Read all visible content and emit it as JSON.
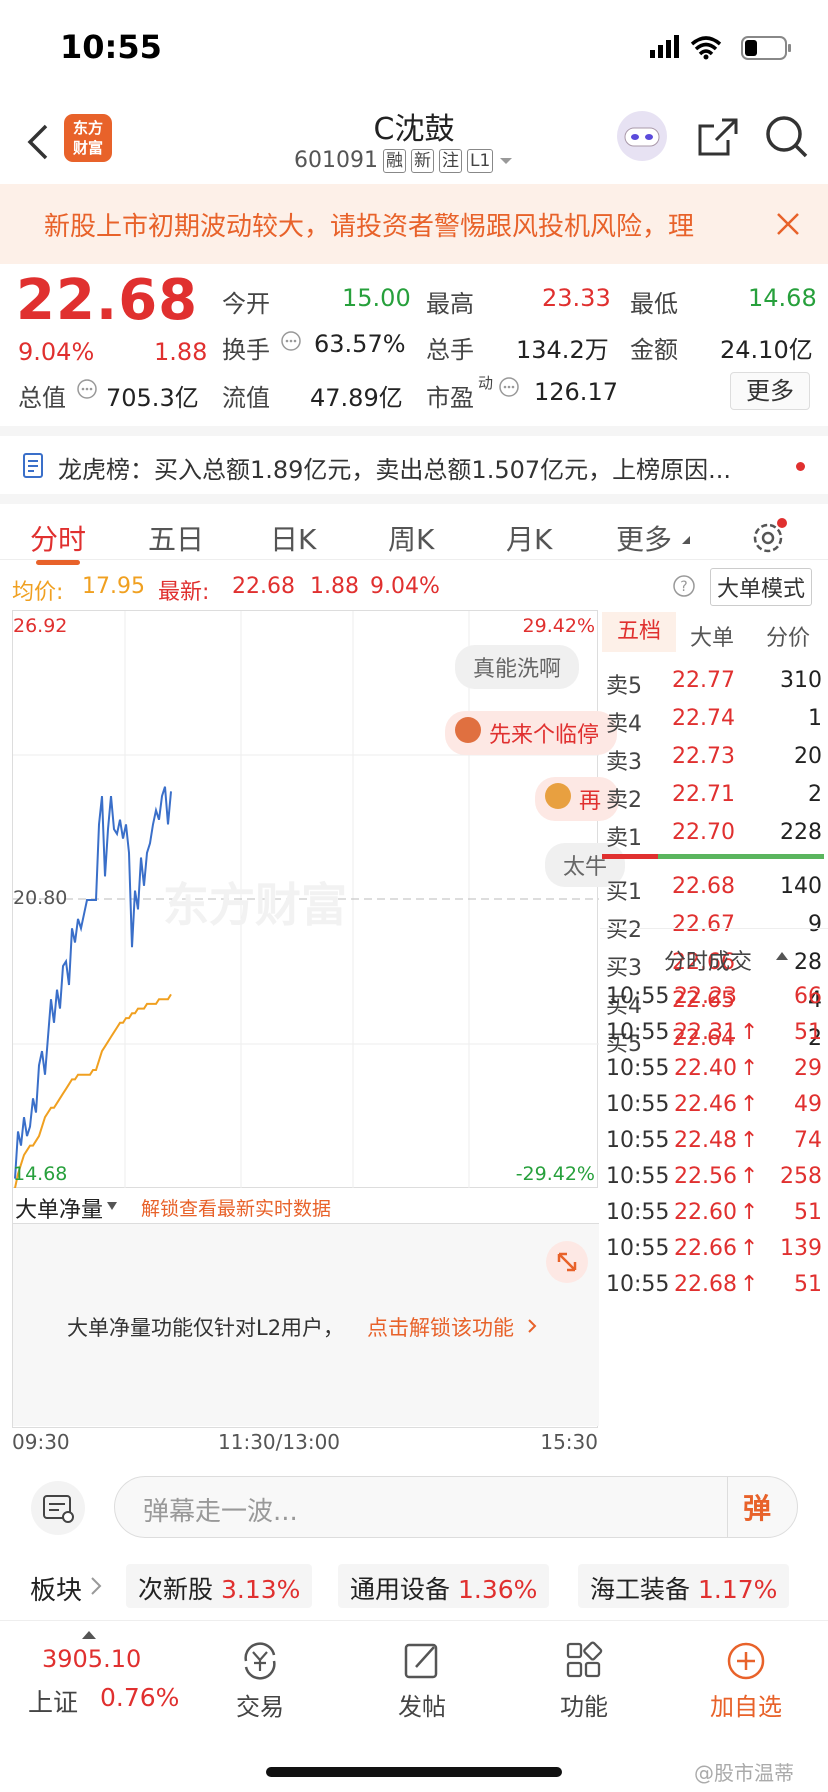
{
  "status_bar": {
    "time": "10:55"
  },
  "header": {
    "title": "C沈鼓",
    "code": "601091",
    "tags": [
      "融",
      "新",
      "注",
      "L1"
    ],
    "logo_text": "东方财富"
  },
  "warning": {
    "text": "新股上市初期波动较大，请投资者警惕跟风投机风险，理"
  },
  "quote": {
    "price": "22.68",
    "change_pct": "9.04%",
    "change": "1.88",
    "open_label": "今开",
    "open": "15.00",
    "high_label": "最高",
    "high": "23.33",
    "low_label": "最低",
    "low": "14.68",
    "turnover_label": "换手",
    "turnover": "63.57%",
    "volume_label": "总手",
    "volume": "134.2万",
    "amount_label": "金额",
    "amount": "24.10亿",
    "mktcap_label": "总值",
    "mktcap": "705.3亿",
    "float_label": "流值",
    "float": "47.89亿",
    "pe_label": "市盈",
    "pe_sup": "动",
    "pe": "126.17",
    "more": "更多"
  },
  "dragon_tiger": {
    "text": "龙虎榜：买入总额1.89亿元，卖出总额1.507亿元，上榜原因..."
  },
  "tabs": [
    "分时",
    "五日",
    "日K",
    "周K",
    "月K",
    "更多"
  ],
  "info_bar": {
    "avg_label": "均价:",
    "avg": "17.95",
    "latest_label": "最新:",
    "latest": "22.68",
    "chg": "1.88",
    "pct": "9.04%",
    "mode": "大单模式"
  },
  "chart_labels": {
    "y_max": "26.92",
    "y_mid": "20.80",
    "y_min": "14.68",
    "pct_max": "29.42%",
    "pct_min": "-29.42%",
    "watermark": "东方财富"
  },
  "danmaku": [
    "真能洗啊",
    "先来个临停",
    "再",
    "太牛"
  ],
  "chart_data": {
    "type": "line",
    "ylim": [
      14.68,
      26.92
    ],
    "series": [
      {
        "values": [
          14.9,
          15.9,
          15.6,
          16.2,
          15.8,
          16.0,
          16.6,
          16.3,
          17.3,
          17.6,
          17.1,
          17.9,
          18.7,
          18.2,
          18.9,
          18.5,
          19.4,
          19.5,
          19.0,
          20.2,
          19.9,
          20.4,
          20.2,
          20.5,
          20.8,
          20.8,
          20.8,
          20.8,
          22.4,
          23.0,
          21.3,
          22.3,
          23.0,
          22.3,
          22.2,
          22.5,
          22.1,
          22.4,
          21.8,
          19.8,
          21.0,
          20.6,
          21.7,
          21.1,
          21.8,
          22.0,
          22.4,
          22.7,
          22.5,
          23.0,
          23.2,
          22.4,
          23.1
        ]
      },
      {
        "values": [
          14.7,
          15.0,
          15.2,
          15.4,
          15.5,
          15.6,
          15.6,
          15.7,
          15.8,
          16.0,
          16.2,
          16.3,
          16.4,
          16.4,
          16.5,
          16.6,
          16.7,
          16.8,
          16.9,
          17.0,
          17.0,
          17.1,
          17.1,
          17.1,
          17.1,
          17.1,
          17.2,
          17.2,
          17.4,
          17.6,
          17.7,
          17.8,
          17.9,
          18.0,
          18.1,
          18.2,
          18.2,
          18.3,
          18.3,
          18.4,
          18.4,
          18.5,
          18.5,
          18.5,
          18.6,
          18.6,
          18.6,
          18.6,
          18.7,
          18.7,
          18.7,
          18.7,
          18.8
        ]
      }
    ]
  },
  "order_book": {
    "tabs": [
      "五档",
      "大单",
      "分价"
    ],
    "asks": [
      {
        "label": "卖5",
        "price": "22.77",
        "vol": "310"
      },
      {
        "label": "卖4",
        "price": "22.74",
        "vol": "1"
      },
      {
        "label": "卖3",
        "price": "22.73",
        "vol": "20"
      },
      {
        "label": "卖2",
        "price": "22.71",
        "vol": "2"
      },
      {
        "label": "卖1",
        "price": "22.70",
        "vol": "228"
      }
    ],
    "bids": [
      {
        "label": "买1",
        "price": "22.68",
        "vol": "140"
      },
      {
        "label": "买2",
        "price": "22.67",
        "vol": "9"
      },
      {
        "label": "买3",
        "price": "22.66",
        "vol": "28"
      },
      {
        "label": "买4",
        "price": "22.65",
        "vol": "4"
      },
      {
        "label": "买5",
        "price": "22.64",
        "vol": "2"
      }
    ]
  },
  "trades": {
    "title": "分时成交",
    "rows": [
      {
        "time": "10:55",
        "price": "22.23",
        "arrow": "",
        "vol": "66"
      },
      {
        "time": "10:55",
        "price": "22.31",
        "arrow": "↑",
        "vol": "51"
      },
      {
        "time": "10:55",
        "price": "22.40",
        "arrow": "↑",
        "vol": "29"
      },
      {
        "time": "10:55",
        "price": "22.46",
        "arrow": "↑",
        "vol": "49"
      },
      {
        "time": "10:55",
        "price": "22.48",
        "arrow": "↑",
        "vol": "74"
      },
      {
        "time": "10:55",
        "price": "22.56",
        "arrow": "↑",
        "vol": "258"
      },
      {
        "time": "10:55",
        "price": "22.60",
        "arrow": "↑",
        "vol": "51"
      },
      {
        "time": "10:55",
        "price": "22.66",
        "arrow": "↑",
        "vol": "139"
      },
      {
        "time": "10:55",
        "price": "22.68",
        "arrow": "↑",
        "vol": "51"
      }
    ]
  },
  "volume_panel": {
    "selector": "大单净量",
    "unlock_link": "解锁查看最新实时数据",
    "notice": "大单净量功能仅针对L2用户，",
    "notice_link": "点击解锁该功能"
  },
  "time_axis": [
    "09:30",
    "11:30/13:00",
    "15:30"
  ],
  "danmu_input": {
    "placeholder": "弹幕走一波...",
    "send": "弹"
  },
  "plates": {
    "label": "板块",
    "items": [
      {
        "name": "次新股",
        "pct": "3.13%"
      },
      {
        "name": "通用设备",
        "pct": "1.36%"
      },
      {
        "name": "海工装备",
        "pct": "1.17%"
      }
    ]
  },
  "bottom_nav": {
    "index_value": "3905.10",
    "index_name": "上证",
    "index_pct": "0.76%",
    "items": [
      "交易",
      "发帖",
      "功能",
      "加自选"
    ]
  },
  "watermark_credit": "@股市温蒂",
  "colors": {
    "up": "#e0302f",
    "down": "#27a03c",
    "accent": "#e8622a",
    "price_line": "#3a6fc9",
    "avg_line": "#f0a020"
  }
}
